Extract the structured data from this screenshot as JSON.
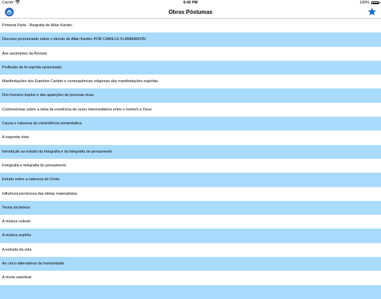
{
  "status_bar": {
    "carrier": "Carrier",
    "time": "6:42 PM",
    "battery_percent": "100%"
  },
  "nav": {
    "title": "Obras Póstumas",
    "left_icon": "app-logo-icon",
    "right_icon": "star-icon",
    "accent_color": "#1f6fd1"
  },
  "colors": {
    "row_alt": "#a9dbfc",
    "row_base": "#ffffff"
  },
  "items": [
    {
      "label": "Primeira Parte - Biografia de Allan Kardec",
      "style": "white"
    },
    {
      "label": "Discurso pronunciado sobre o túmulo de Allan Kardec POR CAMILLE FLAMMARION",
      "style": "blue"
    },
    {
      "label": "Aos assinantes da Revista",
      "style": "white"
    },
    {
      "label": "Profissão de fé espírita raciocinada",
      "style": "blue"
    },
    {
      "label": "Manifestações dos Espíritos Caráter e consequências religiosas das manifestações espíritas",
      "style": "white"
    },
    {
      "label": "Dos homens duplos e das aparições de pessoas vivas",
      "style": "blue"
    },
    {
      "label": "Controvérsias sobre a idéia da existência de seres intermediários entre o homem e Deus",
      "style": "white"
    },
    {
      "label": "Causa e natureza da clarividência sonambúlica",
      "style": "blue"
    },
    {
      "label": "A segunda vista",
      "style": "white"
    },
    {
      "label": "Introdução ao estudo da fotografia e da telegrafia do pensamento",
      "style": "blue"
    },
    {
      "label": "Fotografia e telegrafia do pensamento",
      "style": "white"
    },
    {
      "label": "Estudo sobre a natureza do Cristo",
      "style": "blue"
    },
    {
      "label": "Influência perniciosa das idéias materialistas",
      "style": "white"
    },
    {
      "label": "Teoria da beleza",
      "style": "blue"
    },
    {
      "label": "A música celeste",
      "style": "white"
    },
    {
      "label": "A música espírita",
      "style": "blue"
    },
    {
      "label": "A estrada da vida",
      "style": "white"
    },
    {
      "label": "As cinco alternativas da humanidade",
      "style": "blue"
    },
    {
      "label": "A morte espiritual",
      "style": "white"
    },
    {
      "label": "",
      "style": "blue"
    }
  ]
}
